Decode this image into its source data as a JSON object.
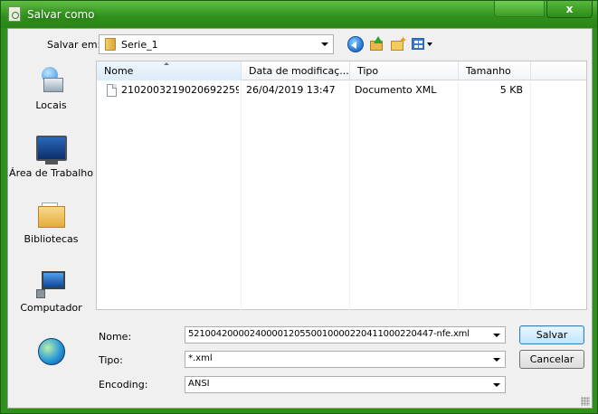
{
  "window": {
    "title": "Salvar como",
    "close_label": "x"
  },
  "toolbar": {
    "save_in_label": "Salvar em:",
    "save_in_value": "Serie_1"
  },
  "places": [
    {
      "label": "Locais",
      "icon": "recent-places-icon"
    },
    {
      "label": "Área de Trabalho",
      "icon": "desktop-icon"
    },
    {
      "label": "Bibliotecas",
      "icon": "libraries-icon"
    },
    {
      "label": "Computador",
      "icon": "computer-icon"
    },
    {
      "label": "",
      "icon": "network-icon"
    }
  ],
  "filelist": {
    "columns": [
      "Nome",
      "Data de modificaç...",
      "Tipo",
      "Tamanho"
    ],
    "sorted_column": "Nome",
    "rows": [
      {
        "name": "2102003219020692259...",
        "date": "26/04/2019 13:47",
        "type": "Documento XML",
        "size": "5 KB"
      }
    ]
  },
  "form": {
    "name_label": "Nome:",
    "name_value": "52100420000240000120550010000220411000220447-nfe.xml",
    "type_label": "Tipo:",
    "type_value": "*.xml",
    "encoding_label": "Encoding:",
    "encoding_value": "ANSI",
    "save_button": "Salvar",
    "cancel_button": "Cancelar"
  }
}
